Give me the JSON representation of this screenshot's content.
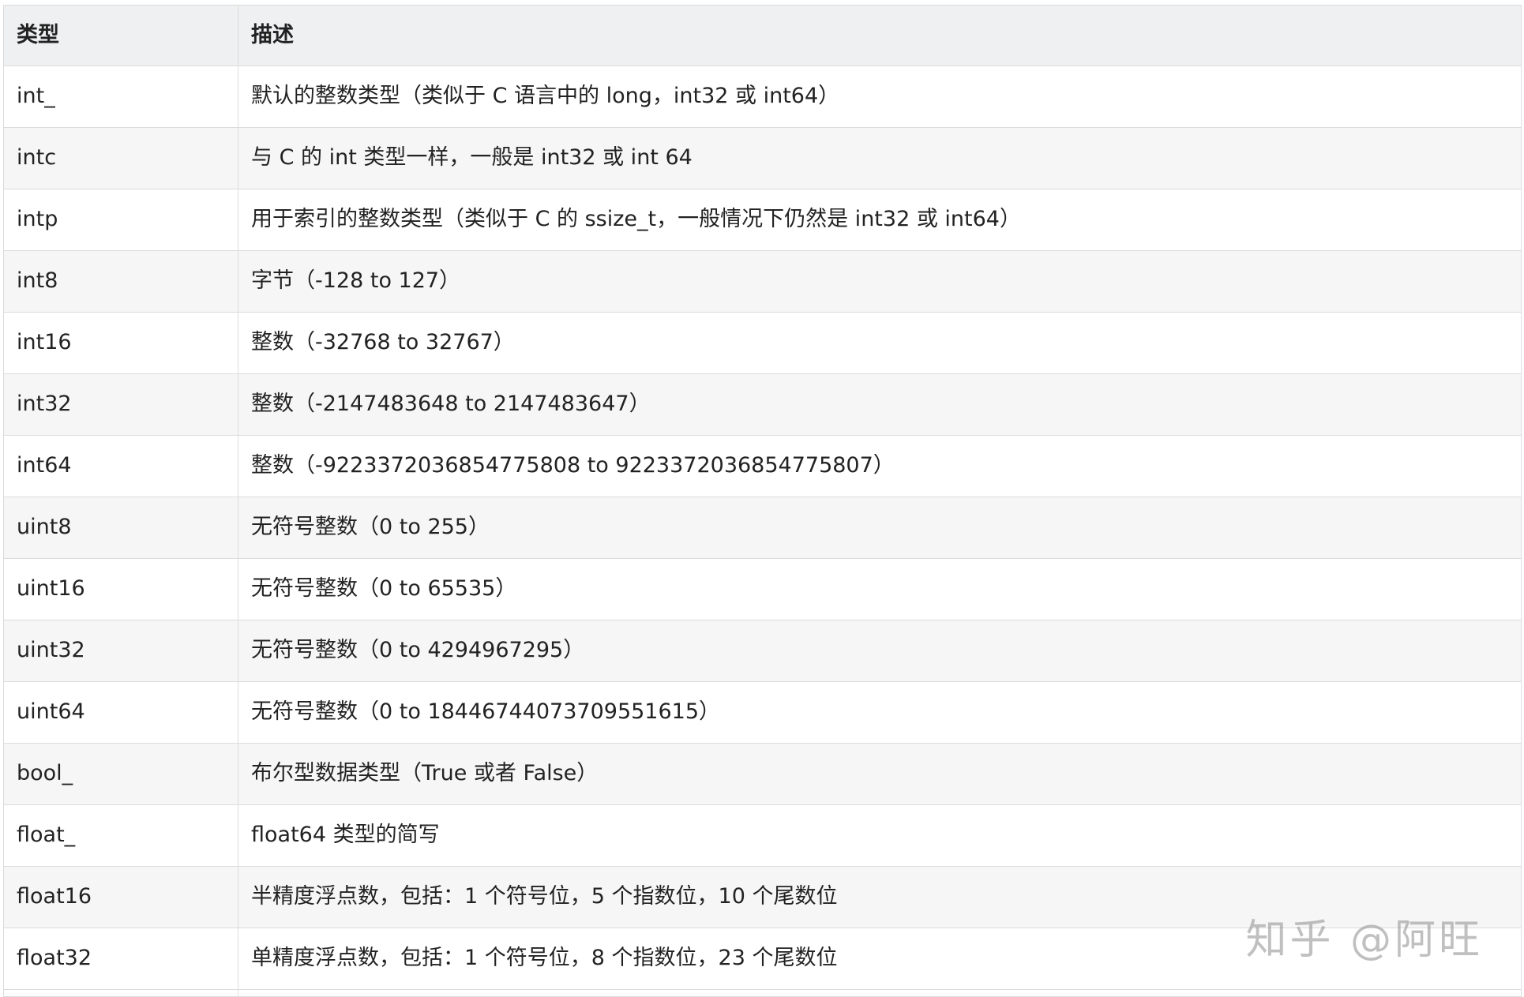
{
  "table": {
    "headers": [
      "类型",
      "描述"
    ],
    "rows": [
      {
        "type": "int_",
        "desc": "默认的整数类型（类似于 C 语言中的 long，int32 或 int64）"
      },
      {
        "type": "intc",
        "desc": "与 C 的 int 类型一样，一般是 int32 或 int 64"
      },
      {
        "type": "intp",
        "desc": "用于索引的整数类型（类似于 C 的 ssize_t，一般情况下仍然是 int32 或 int64）"
      },
      {
        "type": "int8",
        "desc": "字节（-128 to 127）"
      },
      {
        "type": "int16",
        "desc": "整数（-32768 to 32767）"
      },
      {
        "type": "int32",
        "desc": "整数（-2147483648 to 2147483647）"
      },
      {
        "type": "int64",
        "desc": "整数（-9223372036854775808 to 9223372036854775807）"
      },
      {
        "type": "uint8",
        "desc": "无符号整数（0 to 255）"
      },
      {
        "type": "uint16",
        "desc": "无符号整数（0 to 65535）"
      },
      {
        "type": "uint32",
        "desc": "无符号整数（0 to 4294967295）"
      },
      {
        "type": "uint64",
        "desc": "无符号整数（0 to 18446744073709551615）"
      },
      {
        "type": "bool_",
        "desc": "布尔型数据类型（True 或者 False）"
      },
      {
        "type": "float_",
        "desc": "float64 类型的简写"
      },
      {
        "type": "float16",
        "desc": "半精度浮点数，包括：1 个符号位，5 个指数位，10 个尾数位"
      },
      {
        "type": "float32",
        "desc": "单精度浮点数，包括：1 个符号位，8 个指数位，23 个尾数位"
      }
    ]
  },
  "watermark": "知乎 @阿旺"
}
